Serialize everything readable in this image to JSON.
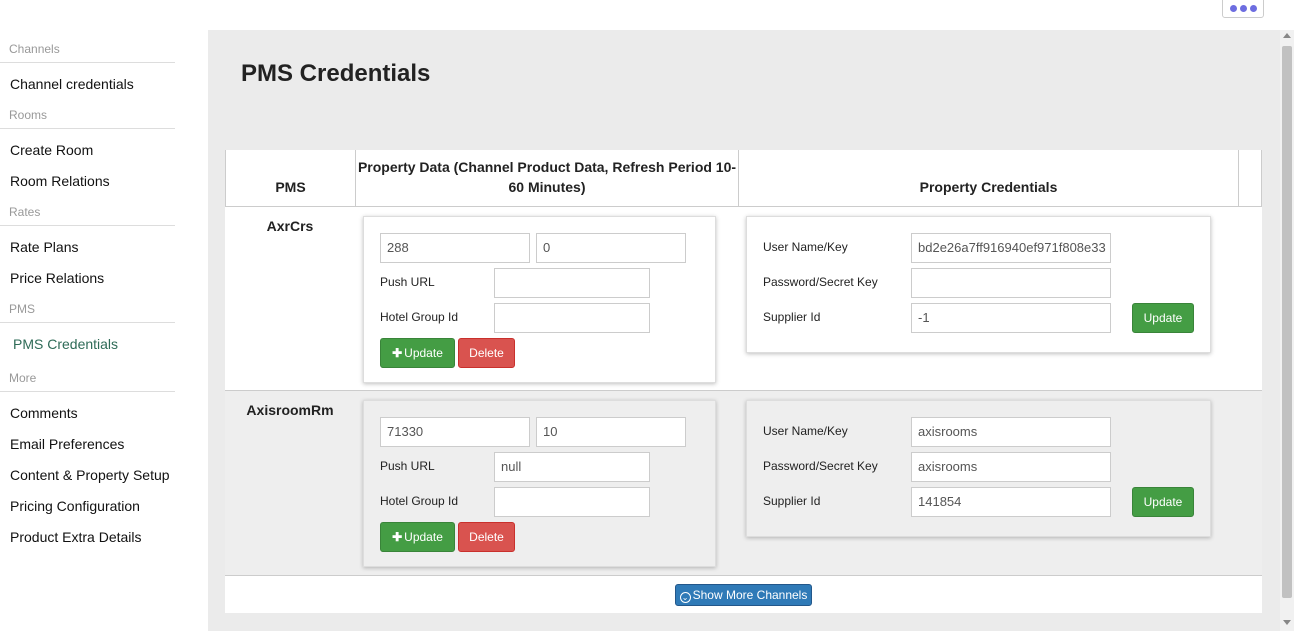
{
  "sidebar": {
    "sections": [
      {
        "title": "Channels",
        "items": [
          "Channel credentials"
        ]
      },
      {
        "title": "Rooms",
        "items": [
          "Create Room",
          "Room Relations"
        ]
      },
      {
        "title": "Rates",
        "items": [
          "Rate Plans",
          "Price Relations"
        ]
      },
      {
        "title": "PMS",
        "items": [
          "PMS Credentials"
        ]
      },
      {
        "title": "More",
        "items": [
          "Comments",
          "Email Preferences",
          "Content & Property Setup",
          "Pricing Configuration",
          "Product Extra Details"
        ]
      }
    ],
    "active_item": "PMS Credentials"
  },
  "page": {
    "title": "PMS Credentials"
  },
  "table": {
    "headers": {
      "pms": "PMS",
      "property_data": "Property Data (Channel Product Data, Refresh Period 10-60 Minutes)",
      "property_credentials": "Property Credentials"
    },
    "rows": [
      {
        "pms": "AxrCrs",
        "field1": "288",
        "field2": "0",
        "push_url_label": "Push URL",
        "push_url": "",
        "hotel_group_label": "Hotel Group Id",
        "hotel_group_id": "",
        "update_label": "Update",
        "delete_label": "Delete",
        "username_label": "User Name/Key",
        "username": "bd2e26a7ff916940ef971f808e33",
        "password_label": "Password/Secret Key",
        "password": "",
        "supplier_label": "Supplier Id",
        "supplier_id": "-1",
        "cred_update_label": "Update"
      },
      {
        "pms": "AxisroomRm",
        "field1": "71330",
        "field2": "10",
        "push_url_label": "Push URL",
        "push_url": "null",
        "hotel_group_label": "Hotel Group Id",
        "hotel_group_id": "",
        "update_label": "Update",
        "delete_label": "Delete",
        "username_label": "User Name/Key",
        "username": "axisrooms",
        "password_label": "Password/Secret Key",
        "password": "axisrooms",
        "supplier_label": "Supplier Id",
        "supplier_id": "141854",
        "cred_update_label": "Update"
      }
    ],
    "show_more_label": "Show More Channels"
  },
  "colors": {
    "primary_green": "#449d44",
    "danger_red": "#d9534f",
    "info_blue": "#2f7ab7",
    "active_link": "#2e6b57",
    "menu_dots": "#6d6de0"
  }
}
